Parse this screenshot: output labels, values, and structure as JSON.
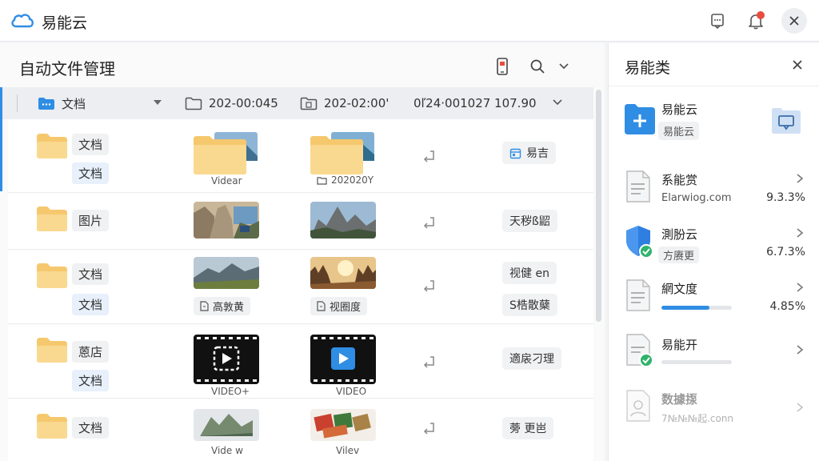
{
  "app": {
    "title": "易能云"
  },
  "main": {
    "title": "自动文件管理",
    "path": {
      "seg1": "文档",
      "seg2": "202-00:045",
      "seg3": "202-02:00'",
      "seg4": "0ľ24·001027 107.90"
    },
    "rows": [
      {
        "name": "文档",
        "tag": "文档",
        "cap1": "Videar",
        "cap2": "202020Y",
        "status": "易吉"
      },
      {
        "name": "图片",
        "tag": "",
        "cap1": "",
        "cap2": "",
        "status": "天秽ß鼦"
      },
      {
        "name": "文档",
        "tag": "文档",
        "cap1": "高敦黄",
        "cap2": "视圈度",
        "status": "视健 en",
        "status2": "S梏散蘖"
      },
      {
        "name": "蒽店",
        "tag": "文档",
        "cap1": "VIDEO+",
        "cap2": "VIDEO",
        "status": "適扆刁理"
      },
      {
        "name": "文档",
        "tag": "",
        "cap1": "Vide w",
        "cap2": "Vilev",
        "status": "蒡  更岜"
      }
    ]
  },
  "side": {
    "title": "易能类",
    "items": [
      {
        "name": "易能云",
        "sub": "易能云"
      },
      {
        "name": "系能赏",
        "sub": "Elarwiog.com",
        "value": "9.3.3%"
      },
      {
        "name": "測肦云",
        "sub": "方赓更",
        "value": "6.7.3%"
      },
      {
        "name": "網文度",
        "value": "4.85%",
        "progress": 0.68
      },
      {
        "name": "易能开",
        "progress": 0.0
      },
      {
        "name": "数據揼",
        "sub": "7№№№起.conn"
      }
    ]
  },
  "colors": {
    "accent": "#2f8de4",
    "folder": "#f6c86e",
    "badge": "#e84c3d"
  }
}
